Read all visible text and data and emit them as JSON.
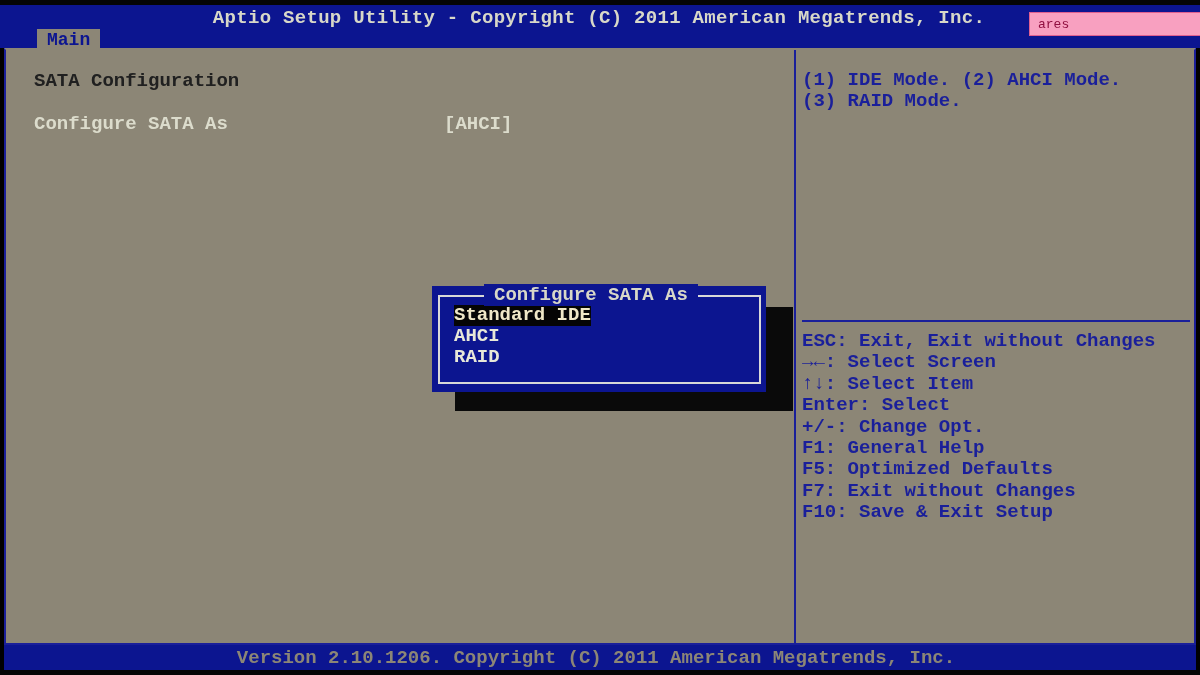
{
  "window": {
    "title": "Aptio Setup Utility - Copyright (C) 2011 American Megatrends, Inc.",
    "user_field": {
      "value": "ares"
    }
  },
  "tabs": [
    {
      "label": "Main",
      "selected": true
    }
  ],
  "section_title": "SATA Configuration",
  "settings": [
    {
      "label": "Configure SATA As",
      "value": "[AHCI]"
    }
  ],
  "help_text": [
    "(1) IDE Mode. (2) AHCI Mode.",
    "(3) RAID Mode."
  ],
  "key_help": [
    "ESC: Exit, Exit without Changes",
    "→←: Select Screen",
    "↑↓: Select Item",
    "Enter: Select",
    "+/-: Change Opt.",
    "F1: General Help",
    "F5: Optimized Defaults",
    "F7: Exit without Changes",
    "F10: Save & Exit Setup"
  ],
  "popup": {
    "title": "Configure SATA As",
    "options": [
      {
        "label": "Standard IDE",
        "selected": true
      },
      {
        "label": "AHCI",
        "selected": false
      },
      {
        "label": "RAID",
        "selected": false
      }
    ]
  },
  "footer": "Version 2.10.1206. Copyright (C) 2011 American Megatrends, Inc."
}
